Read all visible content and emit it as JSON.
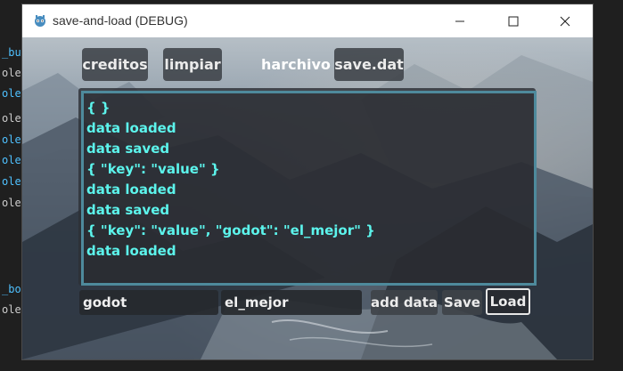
{
  "background_editor": {
    "lines": [
      "_bu",
      "ole",
      "ole",
      "ole",
      "ole",
      "ole",
      "ole",
      "ole",
      "_bo",
      "ole"
    ]
  },
  "window": {
    "title": "save-and-load (DEBUG)",
    "controls": {
      "minimize": "—",
      "maximize": "☐",
      "close": "✕"
    }
  },
  "toolbar": {
    "creditos": "creditos",
    "limpiar": "limpiar",
    "file_label": "harchivo",
    "file_button": "save.dat"
  },
  "log": {
    "lines": [
      "{  }",
      "data loaded",
      "data saved",
      "{ \"key\": \"value\" }",
      "data loaded",
      "data saved",
      "{ \"key\": \"value\", \"godot\": \"el_mejor\" }",
      "data loaded"
    ]
  },
  "inputs": {
    "key_value": "godot",
    "value_value": "el_mejor"
  },
  "actions": {
    "add_data": "add data",
    "save": "Save",
    "load": "Load"
  },
  "colors": {
    "log_text": "#5cf4ec",
    "log_border": "#4e8a9c"
  }
}
